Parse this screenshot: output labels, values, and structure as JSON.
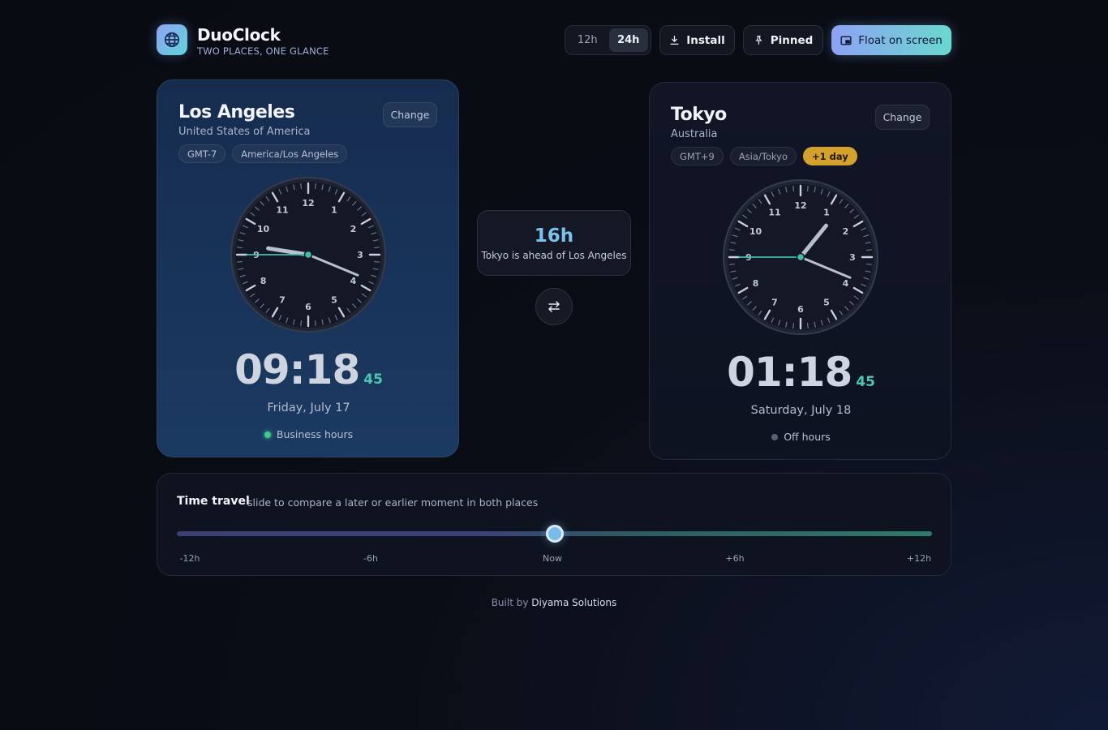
{
  "app": {
    "name": "DuoClock",
    "tagline": "TWO PLACES, ONE GLANCE"
  },
  "header": {
    "format_options": [
      "12h",
      "24h"
    ],
    "format_selected": "24h",
    "install_label": "Install",
    "pinned_label": "Pinned",
    "float_label": "Float on screen"
  },
  "icons": {
    "logo": "globe-icon",
    "install": "download-icon",
    "pinned": "pin-icon",
    "float": "picture-in-picture-icon",
    "swap": "swap-arrows-icon"
  },
  "colors": {
    "accent_gradient_start": "#8ea2f4",
    "accent_gradient_end": "#69d8cf",
    "seconds_color": "#4ec7b3",
    "business_hours_dot": "#3ec98a",
    "day_badge": "#d4a22c"
  },
  "cards": {
    "left": {
      "city": "Los Angeles",
      "country": "United States of America",
      "change_label": "Change",
      "gmt": "GMT-7",
      "zone": "America/Los Angeles",
      "day_badge": "",
      "time_hm": "09:18",
      "time_s": "45",
      "hour": 9,
      "minute": 18,
      "second": 45,
      "date": "Friday, July 17",
      "status": "Business hours",
      "status_active": true
    },
    "right": {
      "city": "Tokyo",
      "country": "Australia",
      "change_label": "Change",
      "gmt": "GMT+9",
      "zone": "Asia/Tokyo",
      "day_badge": "+1 day",
      "time_hm": "01:18",
      "time_s": "45",
      "hour": 1,
      "minute": 18,
      "second": 45,
      "date": "Saturday, July 18",
      "status": "Off hours",
      "status_active": false
    }
  },
  "difference": {
    "value": "16h",
    "text": "Tokyo is ahead of Los Angeles"
  },
  "time_travel": {
    "title": "Time travel",
    "subtitle": "slide to compare a later or earlier moment in both places",
    "min": -12,
    "max": 12,
    "value": 0,
    "ticks": [
      "-12h",
      "-6h",
      "Now",
      "+6h",
      "+12h"
    ]
  },
  "footer": {
    "prefix": "Built by",
    "author": "Diyama Solutions"
  }
}
